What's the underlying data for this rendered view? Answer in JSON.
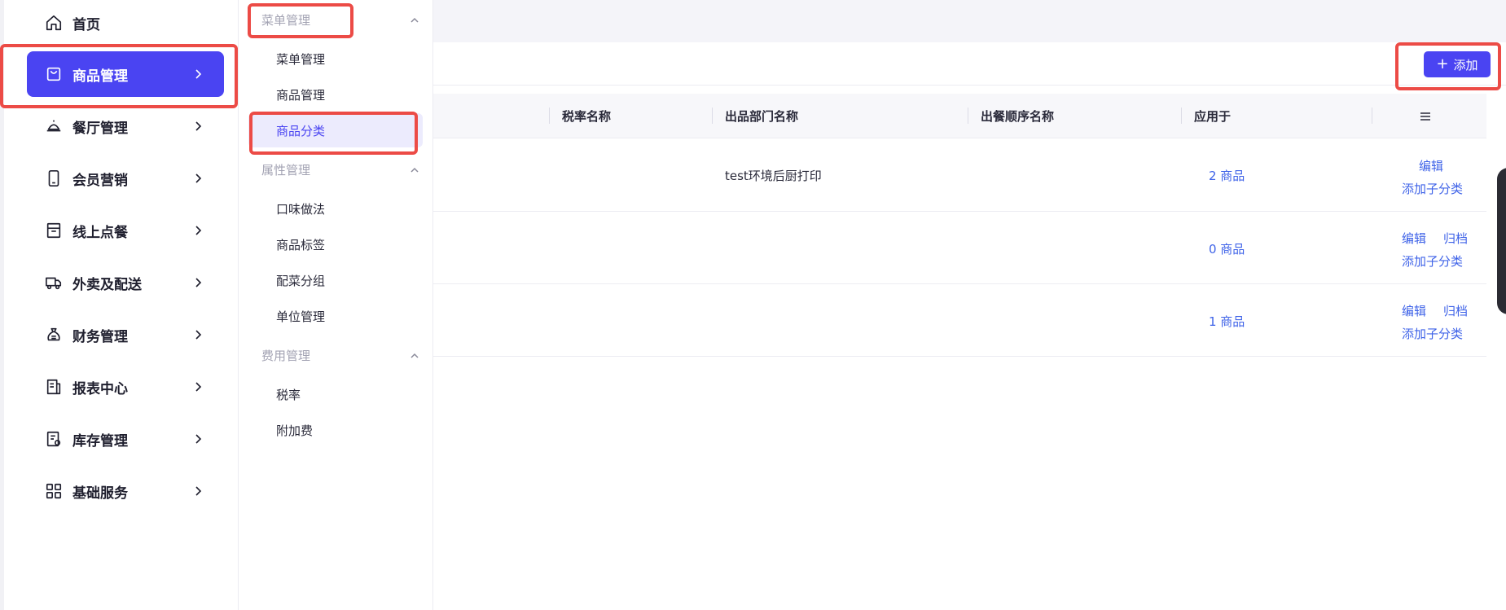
{
  "sidebar": {
    "items": [
      {
        "label": "首页",
        "icon": "home-icon",
        "active": false,
        "has_arrow": false
      },
      {
        "label": "商品管理",
        "icon": "shopping-bag-icon",
        "active": true,
        "has_arrow": true
      },
      {
        "label": "餐厅管理",
        "icon": "food-cloche-icon",
        "active": false,
        "has_arrow": true
      },
      {
        "label": "会员营销",
        "icon": "mobile-phone-icon",
        "active": false,
        "has_arrow": true
      },
      {
        "label": "线上点餐",
        "icon": "storefront-icon",
        "active": false,
        "has_arrow": true
      },
      {
        "label": "外卖及配送",
        "icon": "delivery-truck-icon",
        "active": false,
        "has_arrow": true
      },
      {
        "label": "财务管理",
        "icon": "money-bag-icon",
        "active": false,
        "has_arrow": true
      },
      {
        "label": "报表中心",
        "icon": "report-document-icon",
        "active": false,
        "has_arrow": true
      },
      {
        "label": "库存管理",
        "icon": "inventory-clipboard-icon",
        "active": false,
        "has_arrow": true
      },
      {
        "label": "基础服务",
        "icon": "grid-apps-icon",
        "active": false,
        "has_arrow": true
      }
    ]
  },
  "submenu": {
    "groups": [
      {
        "title": "菜单管理",
        "items": [
          "菜单管理",
          "商品管理",
          "商品分类"
        ]
      },
      {
        "title": "属性管理",
        "items": [
          "口味做法",
          "商品标签",
          "配菜分组",
          "单位管理"
        ]
      },
      {
        "title": "费用管理",
        "items": [
          "税率",
          "附加费"
        ]
      }
    ],
    "active_item": "商品分类"
  },
  "toolbar": {
    "add_label": "添加"
  },
  "table": {
    "columns": [
      "税率名称",
      "出品部门名称",
      "出餐顺序名称",
      "应用于"
    ],
    "rows": [
      {
        "tax": "",
        "department": "test环境后厨打印",
        "order": "",
        "applies": "2 商品",
        "actions": [
          "编辑"
        ],
        "add_sub": "添加子分类"
      },
      {
        "tax": "",
        "department": "",
        "order": "",
        "applies": "0 商品",
        "actions": [
          "编辑",
          "归档"
        ],
        "add_sub": "添加子分类"
      },
      {
        "tax": "",
        "department": "",
        "order": "",
        "applies": "1 商品",
        "actions": [
          "编辑",
          "归档"
        ],
        "add_sub": "添加子分类"
      }
    ]
  },
  "colors": {
    "accent": "#4a44f2",
    "link": "#3f63e8",
    "highlight": "#ec4b46",
    "active_sub_bg": "#ecebfd"
  }
}
